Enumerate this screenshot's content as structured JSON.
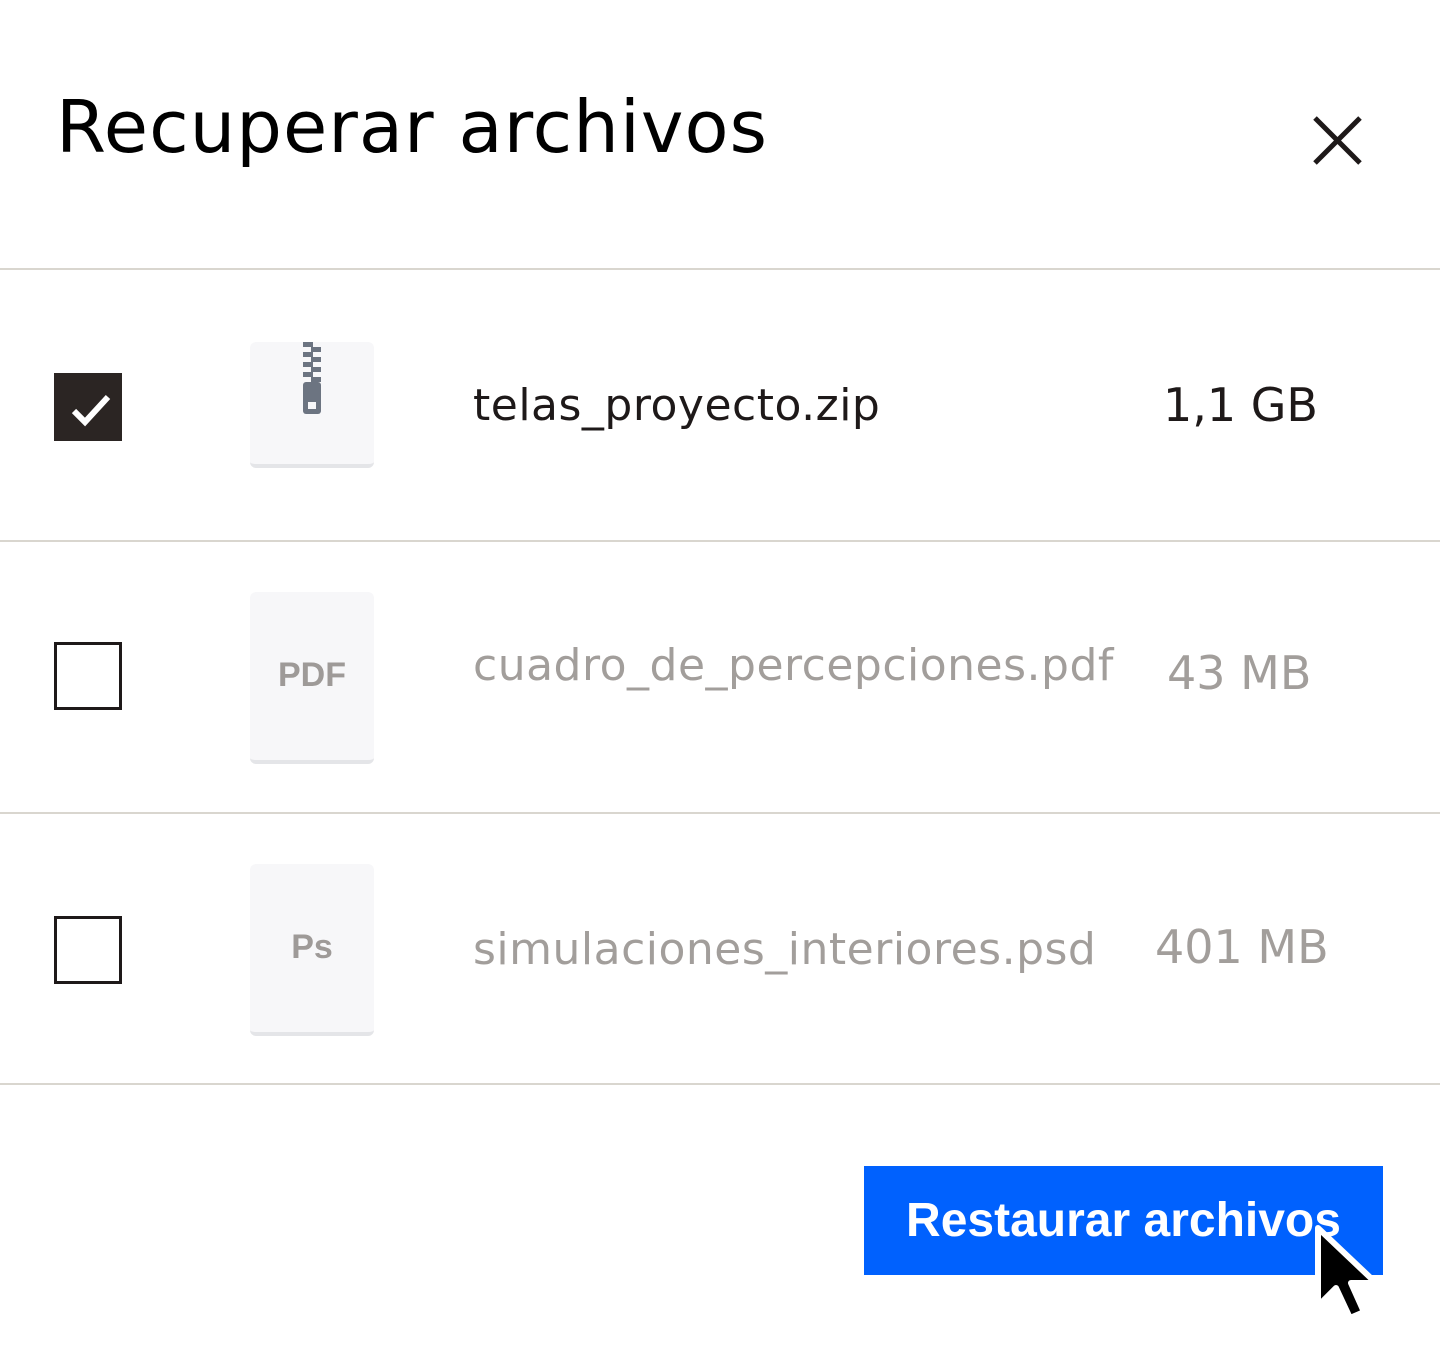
{
  "dialog": {
    "title": "Recuperar archivos",
    "close_icon": "close-icon"
  },
  "files": [
    {
      "checked": true,
      "type_icon": "zip-file-icon",
      "thumb_label": "",
      "name": "telas_proyecto.zip",
      "size": "1,1 GB"
    },
    {
      "checked": false,
      "type_icon": "pdf-file-icon",
      "thumb_label": "PDF",
      "name": "cuadro_de_percepciones.pdf",
      "size": "43 MB"
    },
    {
      "checked": false,
      "type_icon": "psd-file-icon",
      "thumb_label": "Ps",
      "name": "simulaciones_interiores.psd",
      "size": "401 MB"
    }
  ],
  "actions": {
    "restore_label": "Restaurar archivos"
  },
  "colors": {
    "primary": "#0061fe",
    "text": "#1e1919",
    "muted_text": "#a29e9b",
    "divider": "#d9d6cf",
    "checkbox_checked": "#2b2523"
  }
}
